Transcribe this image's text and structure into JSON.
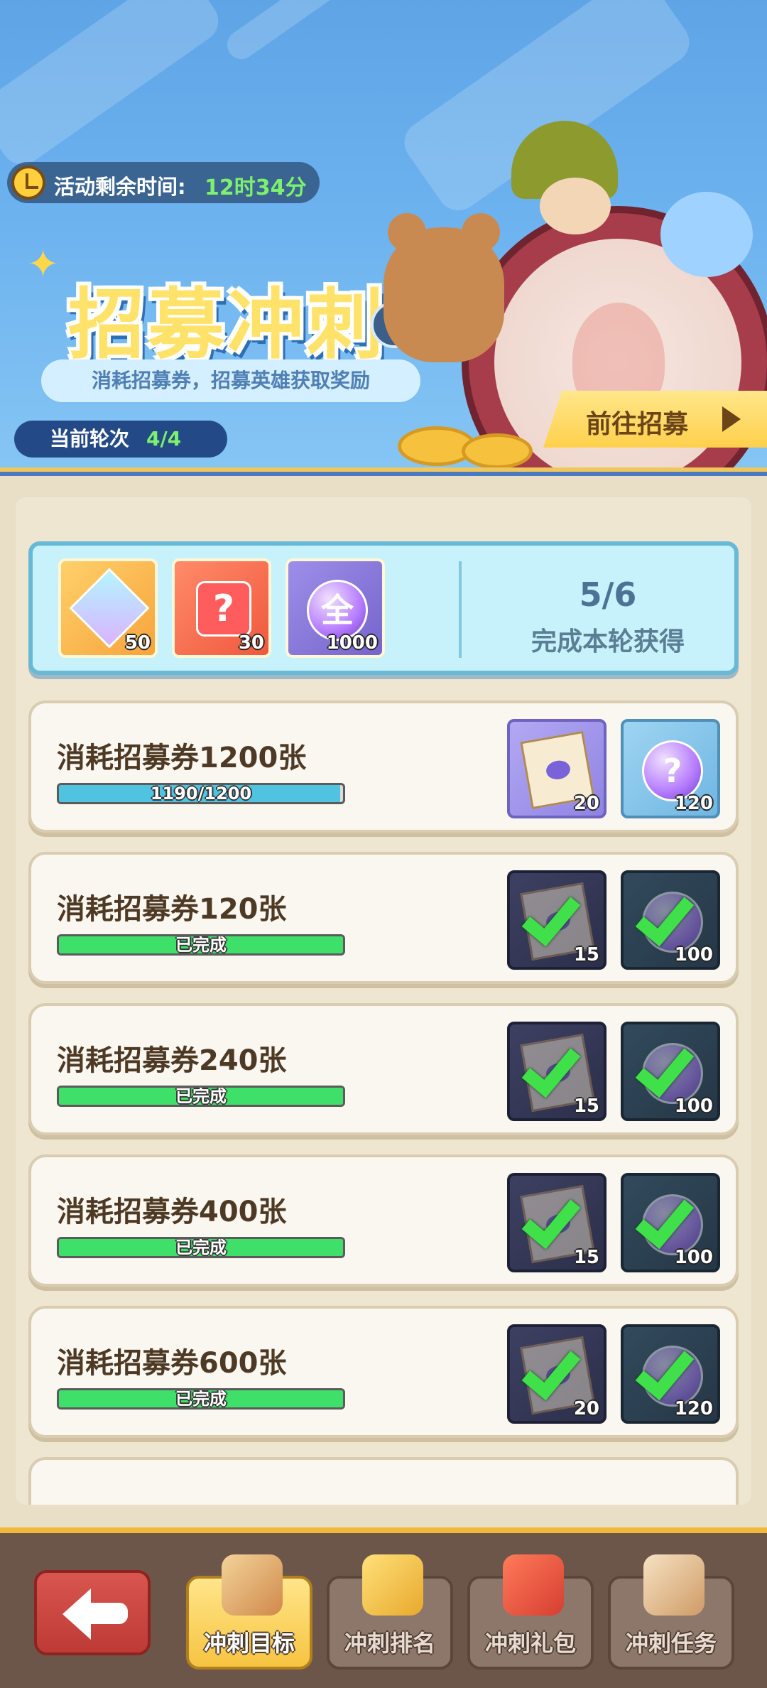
{
  "header": {
    "timer_label": "活动剩余时间:",
    "timer_value": "12时34分",
    "title": "招募冲刺",
    "help_glyph": "?",
    "subtitle": "消耗招募券，招募英雄获取奖励",
    "round_label": "当前轮次",
    "round_value": "4/4",
    "goto_label": "前往招募"
  },
  "summary": {
    "rewards": [
      {
        "icon": "crystal-gem-icon",
        "qty": "50"
      },
      {
        "icon": "mystery-puzzle-icon",
        "glyph": "?",
        "qty": "30"
      },
      {
        "icon": "all-orb-icon",
        "glyph": "全",
        "qty": "1000"
      }
    ],
    "count": "5/6",
    "text": "完成本轮获得"
  },
  "tasks": [
    {
      "title": "消耗招募券1200张",
      "progress": 0.99,
      "progress_text": "1190/1200",
      "done": false,
      "rewards": [
        {
          "icon": "integral-ticket-icon",
          "qty": "20"
        },
        {
          "icon": "mystery-orb-icon",
          "glyph": "?",
          "qty": "120"
        }
      ]
    },
    {
      "title": "消耗招募券120张",
      "progress": 1,
      "progress_text": "已完成",
      "done": true,
      "rewards": [
        {
          "icon": "integral-ticket-icon",
          "qty": "15"
        },
        {
          "icon": "mystery-orb-icon",
          "qty": "100"
        }
      ]
    },
    {
      "title": "消耗招募券240张",
      "progress": 1,
      "progress_text": "已完成",
      "done": true,
      "rewards": [
        {
          "icon": "integral-ticket-icon",
          "qty": "15"
        },
        {
          "icon": "mystery-orb-icon",
          "qty": "100"
        }
      ]
    },
    {
      "title": "消耗招募券400张",
      "progress": 1,
      "progress_text": "已完成",
      "done": true,
      "rewards": [
        {
          "icon": "integral-ticket-icon",
          "qty": "15"
        },
        {
          "icon": "mystery-orb-icon",
          "qty": "100"
        }
      ]
    },
    {
      "title": "消耗招募券600张",
      "progress": 1,
      "progress_text": "已完成",
      "done": true,
      "rewards": [
        {
          "icon": "integral-ticket-icon",
          "qty": "20"
        },
        {
          "icon": "mystery-orb-icon",
          "qty": "120"
        }
      ]
    }
  ],
  "tabs": [
    {
      "label": "冲刺目标",
      "icon": "scroll-icon",
      "active": true
    },
    {
      "label": "冲刺排名",
      "icon": "trophy-icon",
      "active": false
    },
    {
      "label": "冲刺礼包",
      "icon": "gift-chest-icon",
      "active": false
    },
    {
      "label": "冲刺任务",
      "icon": "quill-scroll-icon",
      "active": false
    }
  ],
  "colors": {
    "banner_blue": "#6cb2ef",
    "progress_blue": "#4fc3e0",
    "progress_green": "#3fe06a",
    "check_green": "#3fe04a",
    "title_yellow": "#ffe26a",
    "tab_active": "#f6c441"
  }
}
